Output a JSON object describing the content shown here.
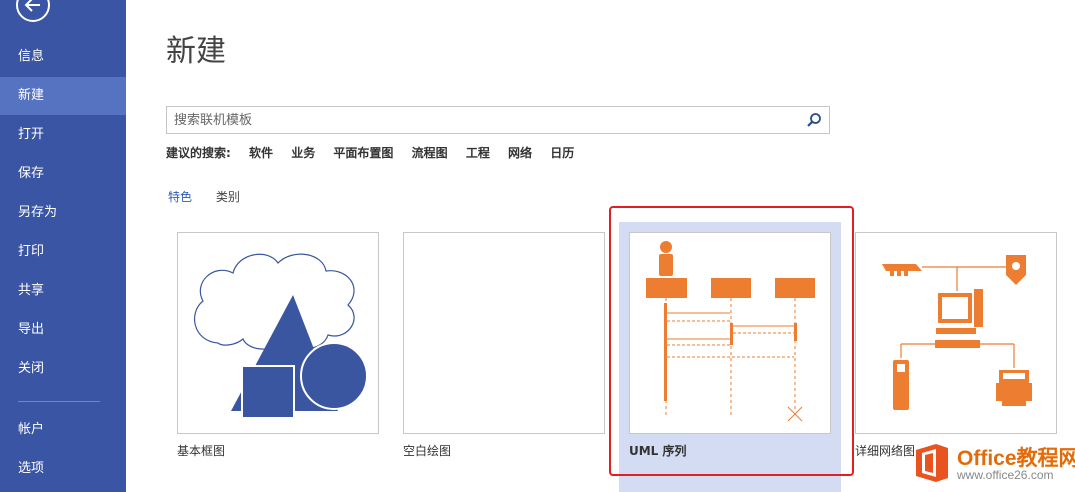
{
  "sidebar": {
    "items": [
      {
        "label": "信息"
      },
      {
        "label": "新建",
        "active": true
      },
      {
        "label": "打开"
      },
      {
        "label": "保存"
      },
      {
        "label": "另存为"
      },
      {
        "label": "打印"
      },
      {
        "label": "共享"
      },
      {
        "label": "导出"
      },
      {
        "label": "关闭"
      },
      {
        "label": "帐户"
      },
      {
        "label": "选项"
      }
    ],
    "back_icon": "arrow-left-circle-icon",
    "bg_color": "#3955a3",
    "active_color": "#5673c2"
  },
  "main": {
    "title": "新建",
    "search": {
      "placeholder": "搜索联机模板",
      "icon": "search-icon"
    },
    "suggested": {
      "label": "建议的搜索:",
      "items": [
        "软件",
        "业务",
        "平面布置图",
        "流程图",
        "工程",
        "网络",
        "日历"
      ]
    },
    "tabs": [
      {
        "label": "特色",
        "active": true
      },
      {
        "label": "类别"
      }
    ],
    "templates": [
      {
        "label": "基本框图",
        "icon": "basic-shapes-icon"
      },
      {
        "label": "空白绘图",
        "icon": "blank-page-icon"
      },
      {
        "label": "UML 序列",
        "icon": "uml-sequence-icon",
        "selected": true
      },
      {
        "label": "详细网络图",
        "icon": "network-diagram-icon"
      }
    ],
    "accent_color": "#ed7d31",
    "highlight_frame_color": "#e02020"
  },
  "watermark": {
    "text": "Office教程网",
    "url": "www.office26.com"
  }
}
